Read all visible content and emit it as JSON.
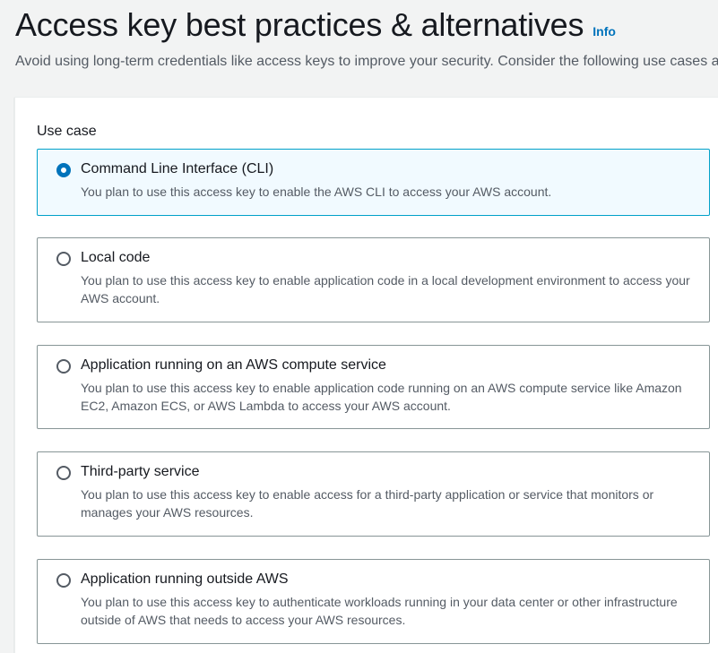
{
  "header": {
    "title": "Access key best practices & alternatives",
    "info_label": "Info",
    "description": "Avoid using long-term credentials like access keys to improve your security. Consider the following use cases and alternatives."
  },
  "form": {
    "use_case_label": "Use case",
    "selected_option": "Command Line Interface (CLI)",
    "options": [
      {
        "title": "Command Line Interface (CLI)",
        "description": "You plan to use this access key to enable the AWS CLI to access your AWS account.",
        "selected": true
      },
      {
        "title": "Local code",
        "description": "You plan to use this access key to enable application code in a local development environment to access your AWS account.",
        "selected": false
      },
      {
        "title": "Application running on an AWS compute service",
        "description": "You plan to use this access key to enable application code running on an AWS compute service like Amazon EC2, Amazon ECS, or AWS Lambda to access your AWS account.",
        "selected": false
      },
      {
        "title": "Third-party service",
        "description": "You plan to use this access key to enable access for a third-party application or service that monitors or manages your AWS resources.",
        "selected": false
      },
      {
        "title": "Application running outside AWS",
        "description": "You plan to use this access key to authenticate workloads running in your data center or other infrastructure outside of AWS that needs to access your AWS resources.",
        "selected": false
      }
    ]
  },
  "colors": {
    "accent": "#0073bb",
    "selected_border": "#00a1c9",
    "selected_background": "#f1faff",
    "page_background": "#f2f3f3"
  }
}
